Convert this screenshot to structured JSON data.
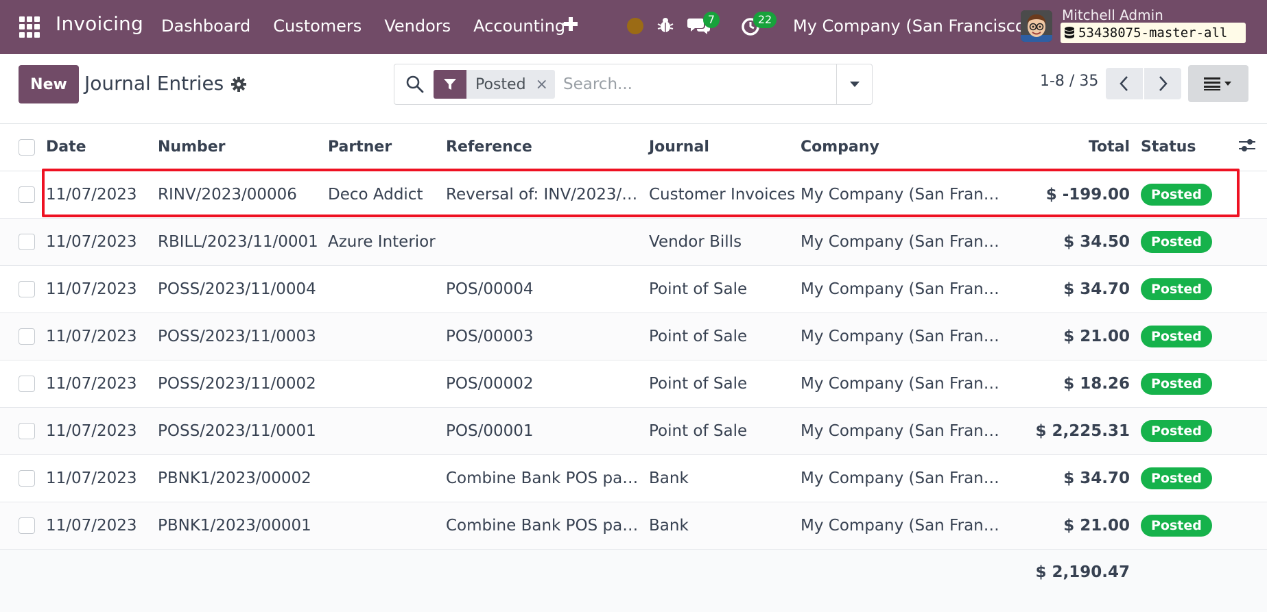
{
  "navbar": {
    "brand": "Invoicing",
    "menu": [
      "Dashboard",
      "Customers",
      "Vendors",
      "Accounting"
    ],
    "chat_count": "7",
    "activity_count": "22",
    "company": "My Company (San Francisco)",
    "user_name": "Mitchell Admin",
    "database": "53438075-master-all",
    "colors": {
      "bar": "#714B67",
      "badge": "#17a23b"
    }
  },
  "control_panel": {
    "new_label": "New",
    "title": "Journal Entries",
    "facet_label": "Posted",
    "facet_remove": "×",
    "search_placeholder": "Search...",
    "pager": "1-8 / 35"
  },
  "table": {
    "headers": {
      "date": "Date",
      "number": "Number",
      "partner": "Partner",
      "reference": "Reference",
      "journal": "Journal",
      "company": "Company",
      "total": "Total",
      "status": "Status"
    },
    "rows": [
      {
        "date": "11/07/2023",
        "number": "RINV/2023/00006",
        "partner": "Deco Addict",
        "reference": "Reversal of: INV/2023/…",
        "journal": "Customer Invoices",
        "company": "My Company (San Fran…",
        "total": "$ -199.00",
        "status": "Posted"
      },
      {
        "date": "11/07/2023",
        "number": "RBILL/2023/11/0001",
        "partner": "Azure Interior",
        "reference": "",
        "journal": "Vendor Bills",
        "company": "My Company (San Fran…",
        "total": "$ 34.50",
        "status": "Posted"
      },
      {
        "date": "11/07/2023",
        "number": "POSS/2023/11/0004",
        "partner": "",
        "reference": "POS/00004",
        "journal": "Point of Sale",
        "company": "My Company (San Fran…",
        "total": "$ 34.70",
        "status": "Posted"
      },
      {
        "date": "11/07/2023",
        "number": "POSS/2023/11/0003",
        "partner": "",
        "reference": "POS/00003",
        "journal": "Point of Sale",
        "company": "My Company (San Fran…",
        "total": "$ 21.00",
        "status": "Posted"
      },
      {
        "date": "11/07/2023",
        "number": "POSS/2023/11/0002",
        "partner": "",
        "reference": "POS/00002",
        "journal": "Point of Sale",
        "company": "My Company (San Fran…",
        "total": "$ 18.26",
        "status": "Posted"
      },
      {
        "date": "11/07/2023",
        "number": "POSS/2023/11/0001",
        "partner": "",
        "reference": "POS/00001",
        "journal": "Point of Sale",
        "company": "My Company (San Fran…",
        "total": "$ 2,225.31",
        "status": "Posted"
      },
      {
        "date": "11/07/2023",
        "number": "PBNK1/2023/00002",
        "partner": "",
        "reference": "Combine Bank POS pa…",
        "journal": "Bank",
        "company": "My Company (San Fran…",
        "total": "$ 34.70",
        "status": "Posted"
      },
      {
        "date": "11/07/2023",
        "number": "PBNK1/2023/00001",
        "partner": "",
        "reference": "Combine Bank POS pa…",
        "journal": "Bank",
        "company": "My Company (San Fran…",
        "total": "$ 21.00",
        "status": "Posted"
      }
    ],
    "grand_total": "$ 2,190.47",
    "status_color": "#16b24b",
    "highlight_color": "#ee1122"
  }
}
